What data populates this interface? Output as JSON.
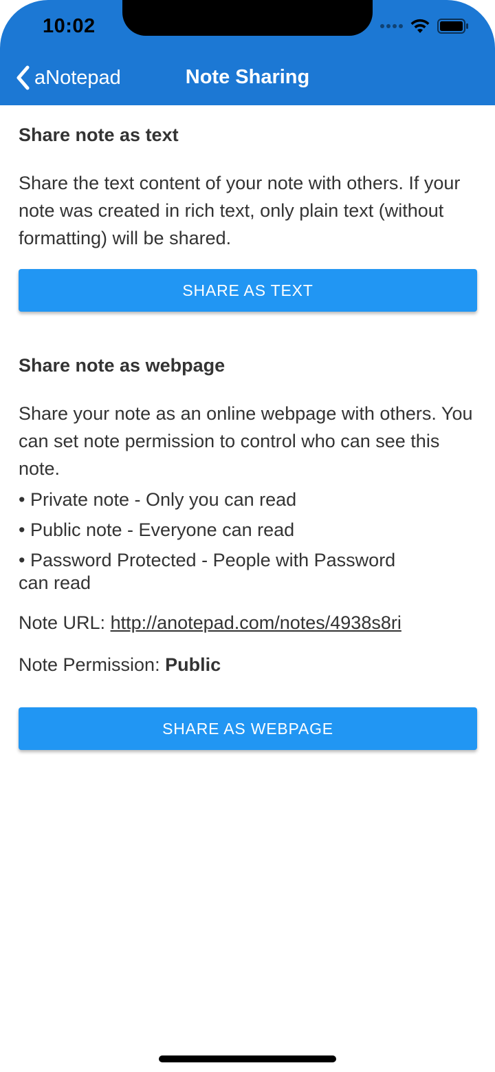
{
  "status_bar": {
    "time": "10:02"
  },
  "nav": {
    "back_label": "aNotepad",
    "title": "Note Sharing"
  },
  "text_section": {
    "heading": "Share note as text",
    "description": "Share the text content of your note with others. If your note was created in rich text, only plain text (without formatting) will be shared.",
    "button_label": "SHARE AS TEXT"
  },
  "webpage_section": {
    "heading": "Share note as webpage",
    "description": "Share your note as an online webpage with others. You can set note permission to control who can see this note.",
    "bullets": [
      "• Private note - Only you can read",
      "• Public note - Everyone can read",
      "• Password Protected - People with Password",
      "can read"
    ],
    "url_label": "Note URL: ",
    "url": "http://anotepad.com/notes/4938s8ri",
    "permission_label": "Note Permission: ",
    "permission_value": "Public",
    "button_label": "SHARE AS WEBPAGE"
  },
  "colors": {
    "header": "#1c78d4",
    "button": "#2196f3",
    "text": "#333333"
  }
}
